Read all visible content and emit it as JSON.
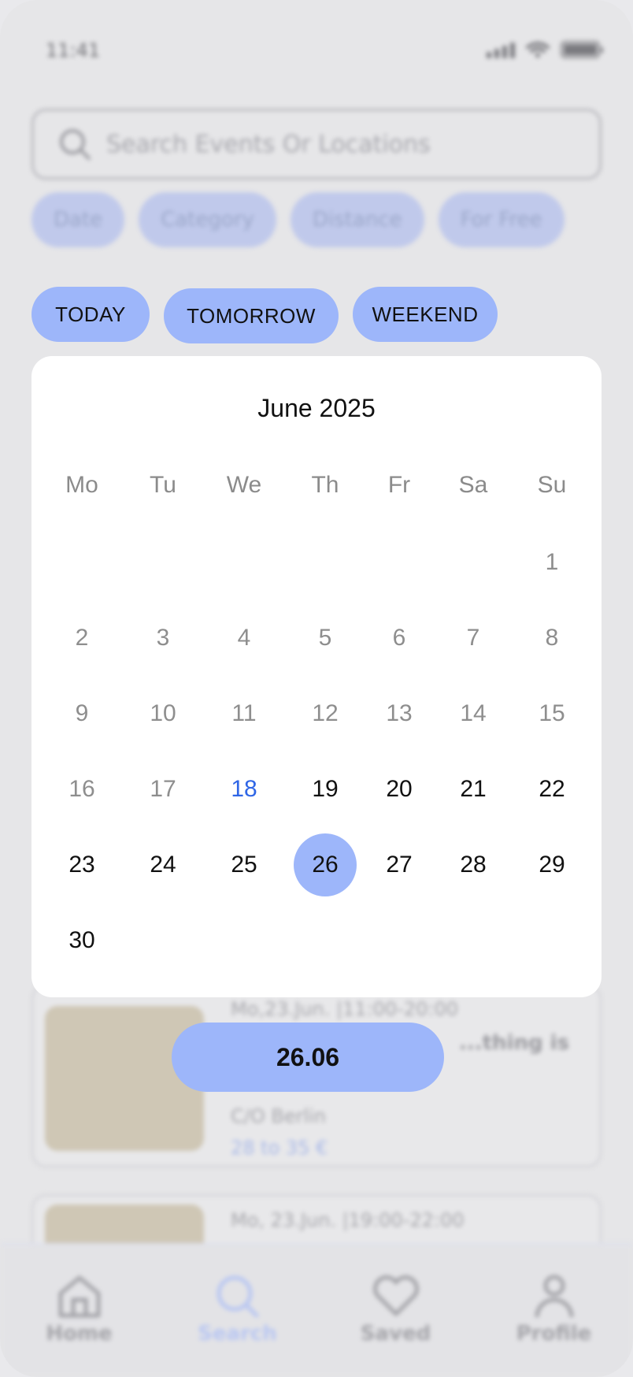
{
  "status_bar": {
    "time": "11:41"
  },
  "search": {
    "placeholder": "Search Events Or Locations"
  },
  "filters": [
    "Date",
    "Category",
    "Distance",
    "For Free"
  ],
  "background_cards": [
    {
      "date": "Mo,23.Jun. |11:00-20:00",
      "title": "...thing is",
      "location": "C/O Berlin",
      "price": "28 to 35 €"
    },
    {
      "date": "Mo, 23.Jun. |19:00-22:00"
    }
  ],
  "quick_dates": {
    "today": "TODAY",
    "tomorrow": "TOMORROW",
    "weekend": "WEEKEND"
  },
  "calendar": {
    "title": "June 2025",
    "weekdays": [
      "Mo",
      "Tu",
      "We",
      "Th",
      "Fr",
      "Sa",
      "Su"
    ],
    "first_weekday_index": 6,
    "days_in_month": 30,
    "today": 18,
    "selected": 26
  },
  "confirm_label": "26.06",
  "tabbar": [
    {
      "label": "Home",
      "icon": "home-icon"
    },
    {
      "label": "Search",
      "icon": "search-icon",
      "active": true
    },
    {
      "label": "Saved",
      "icon": "heart-icon"
    },
    {
      "label": "Profile",
      "icon": "profile-icon"
    }
  ],
  "colors": {
    "accent": "#9db6fa",
    "today_text": "#2f66e6",
    "past_text": "#8e8e8e"
  }
}
